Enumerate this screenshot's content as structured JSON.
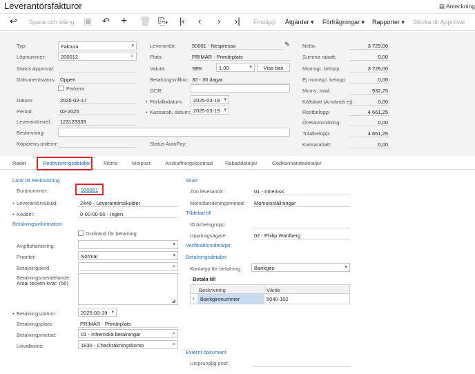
{
  "window": {
    "title": "Leverantörsfakturor",
    "notes_label": "Anteckningar"
  },
  "toolbar": {
    "save_close": "Spara och stäng",
    "frislapp": "Frisläpp",
    "atgarder": "Åtgärder",
    "forfragningar": "Förfrågningar",
    "rapporter": "Rapporter",
    "skicka": "Skicka till Approval",
    "caret": "▾"
  },
  "form": {
    "typ_label": "Typ:",
    "typ_value": "Faktura",
    "lopnummer_label": "Löpnummer:",
    "lopnummer_value": "200012",
    "status_approval_label": "Status Approval:",
    "dokumentstatus_label": "Dokumentstatus:",
    "dokumentstatus_value": "Öppen",
    "parkera_label": "Parkera",
    "datum_label": "Datum:",
    "datum_value": "2025-02-17",
    "period_label": "Period:",
    "period_value": "02-2025",
    "levref_label": "Leverantörsref.:",
    "levref_value": "123123333",
    "beskrivning_label": "Beskrivning:",
    "koparens_label": "Köparens ordernr:",
    "leverantor_label": "Leverantör:",
    "leverantor_value": "50001 - Nespresso",
    "plats_label": "Plats:",
    "plats_value": "PRIMÄR - Primärplats",
    "valuta_label": "Valuta:",
    "valuta_value": "SEK",
    "kurs_value": "1,00",
    "visa_bas": "Visa bas",
    "betvillkor_label": "Betalningsvillkor:",
    "betvillkor_value": "30 - 30 dagar",
    "ocr_label": "OCR:",
    "forfallodatum_label": "Förfallodatum:",
    "forfallodatum_value": "2025-03-19",
    "kassarab_label": "Kassarab. datum:",
    "kassarab_value": "2025-03-19",
    "status_autopay_label": "Status AutoPay:"
  },
  "totals": [
    {
      "label": "Netto:",
      "value": "3 729,00"
    },
    {
      "label": "Summa rabatt:",
      "value": "0,00"
    },
    {
      "label": "Momsgr. belopp:",
      "value": "3 729,00"
    },
    {
      "label": "Ej momspl. belopp:",
      "value": "0,00"
    },
    {
      "label": "Moms, total:",
      "value": "932,25"
    },
    {
      "label": "Källskatt (Används ej):",
      "value": "0,00"
    },
    {
      "label": "Restbelopp:",
      "value": "4 661,25"
    },
    {
      "label": "Öresavrundning:",
      "value": "0,00"
    },
    {
      "label": "Totalbelopp:",
      "value": "4 661,25"
    },
    {
      "label": "Kassarabatt:",
      "value": "0,00"
    }
  ],
  "tabs": [
    "Rader",
    "Redovisningsdetaljer",
    "Moms",
    "Motpost",
    "Anskaffningskostnad",
    "Rabattdetaljer",
    "Godkännandedetaljer"
  ],
  "details": {
    "lank_section": "Länk till Redovisning",
    "buntnummer_label": "Buntnummer:",
    "buntnummer_value": "000061",
    "levskuld_label": "Leverantörsskuld:",
    "levskuld_value": "2440 - Leverantörsskulder",
    "koddel_label": "Koddel:",
    "koddel_value": "0-00-00-00 - Ingen",
    "betinfo_section": "Betalningsinformation",
    "godkand_label": "Godkänd för betalning",
    "avgift_label": "Avgiftshantering:",
    "prioritet_label": "Prioritet:",
    "prioritet_value": "Normal",
    "betkod_label": "Betalningskod:",
    "betmed_label": "Betalningsmeddelande:",
    "antal_label": "Antal tecken kvar: (50)",
    "betdatum_label": "Betalningsdatum:",
    "betdatum_value": "2025-03-19",
    "betplats_label": "Betalningsplats:",
    "betplats_value": "PRIMÄR - Primärplats",
    "betmetod_label": "Betalningsmetod:",
    "betmetod_value": "01 - Inhemska betalningar",
    "likvid_label": "Likvidkonto:",
    "likvid_value": "1930 - Checkräkningskonto",
    "skatt_section": "Skatt",
    "zon_label": "Zon leverantör:",
    "zon_value": "01 - Inhemsk",
    "momsber_label": "Momsberäkningsmetod:",
    "momsber_value": "Momsinställningar",
    "tilldelad_section": "Tilldelad till",
    "idarb_label": "ID Arbetsgrupp:",
    "uppdrag_label": "Uppdragsägare:",
    "uppdrag_value": "02 - Philip Wahlberg",
    "verif_section": "Verifikationsdetaljer",
    "betdet_section": "Betalningsdetaljer",
    "kontotyp_label": "Kontotyp för betalning:",
    "kontotyp_value": "Bankgiro",
    "betala_till": "Betala till",
    "col_beskrivning": "Beskrivning",
    "col_varde": "Värde",
    "row_beskrivning": "Bankgironummer",
    "row_varde": "5040-102",
    "externt_section": "Externt dokument",
    "ursprunglig_label": "Ursprunglig post:"
  },
  "colors": {
    "accent": "#1f5fa8",
    "highlight": "#d6262d",
    "form_bg": "#f3f3f3",
    "selection": "#c9dcef"
  }
}
